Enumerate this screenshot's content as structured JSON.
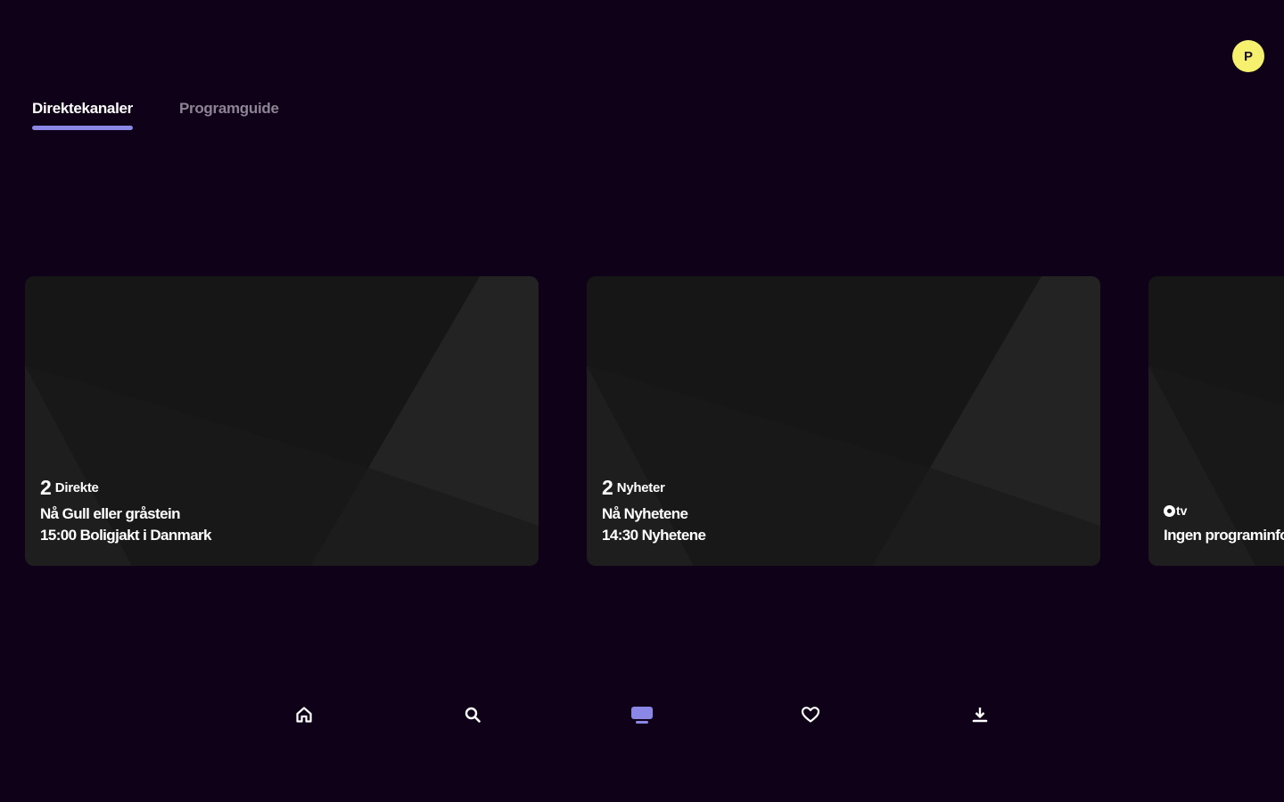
{
  "header": {
    "avatar_initial": "P"
  },
  "tabs": [
    {
      "label": "Direktekanaler",
      "active": true
    },
    {
      "label": "Programguide",
      "active": false
    }
  ],
  "channels": [
    {
      "logo": "2",
      "name": "Direkte",
      "now": "Nå Gull eller gråstein",
      "next": "15:00 Boligjakt i Danmark"
    },
    {
      "logo": "2",
      "name": "Nyheter",
      "now": "Nå Nyhetene",
      "next": "14:30 Nyhetene"
    },
    {
      "logo": "tv",
      "name": "",
      "now": "Ingen programinformasjon",
      "next": ""
    }
  ],
  "bottom_nav": [
    {
      "icon": "home-icon",
      "active": false
    },
    {
      "icon": "search-icon",
      "active": false
    },
    {
      "icon": "tv-icon",
      "active": true
    },
    {
      "icon": "heart-icon",
      "active": false
    },
    {
      "icon": "download-icon",
      "active": false
    }
  ],
  "colors": {
    "background": "#0f0118",
    "accent": "#8b87e6",
    "avatar": "#f5f06e",
    "card": "#161616"
  }
}
